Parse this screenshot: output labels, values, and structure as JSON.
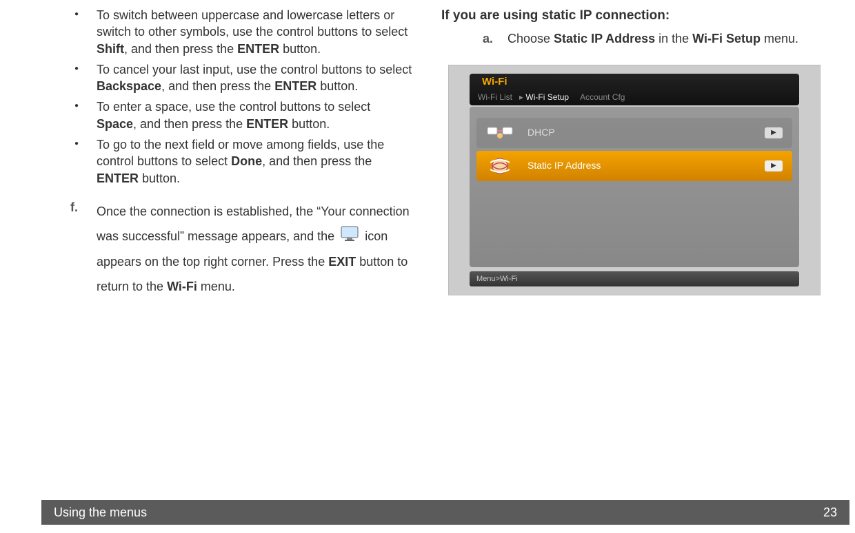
{
  "left": {
    "bullets": [
      {
        "pre": "To switch between uppercase and lowercase letters or switch to other symbols, use the control buttons to select ",
        "b1": "Shift",
        "mid": ", and then press the ",
        "b2": "ENTER",
        "post": " button."
      },
      {
        "pre": "To cancel your last input, use the control buttons to select ",
        "b1": "Backspace",
        "mid": ", and then press the ",
        "b2": "ENTER",
        "post": " button."
      },
      {
        "pre": "To enter a space, use the control buttons to select ",
        "b1": "Space",
        "mid": ", and then press the ",
        "b2": "ENTER",
        "post": " button."
      },
      {
        "pre": "To go to the next field or move among fields, use the control buttons to select ",
        "b1": "Done",
        "mid": ", and then press the ",
        "b2": "ENTER",
        "post": " button."
      }
    ],
    "stepF": {
      "label": "f.",
      "t1": "Once the connection is established, the “Your connection was successful” message appears, and the ",
      "t2": " icon appears on the top right corner. Press the ",
      "b1": "EXIT",
      "t3": " button to return to the ",
      "b2": "Wi-Fi",
      "t4": " menu."
    }
  },
  "right": {
    "heading": "If you are using static IP connection:",
    "stepA": {
      "label": "a.",
      "t1": "Choose ",
      "b1": "Static IP Address",
      "t2": " in the ",
      "b2": "Wi-Fi Setup",
      "t3": " menu."
    },
    "screenshot": {
      "title": "Wi-Fi",
      "tab1": "Wi-Fi  List",
      "tab2": "Wi-Fi Setup",
      "tab3": "Account Cfg",
      "row_dhcp": "DHCP",
      "row_static": "Static IP Address",
      "breadcrumb": "Menu>Wi-Fi"
    }
  },
  "footer": {
    "title": "Using the menus",
    "page": "23"
  }
}
